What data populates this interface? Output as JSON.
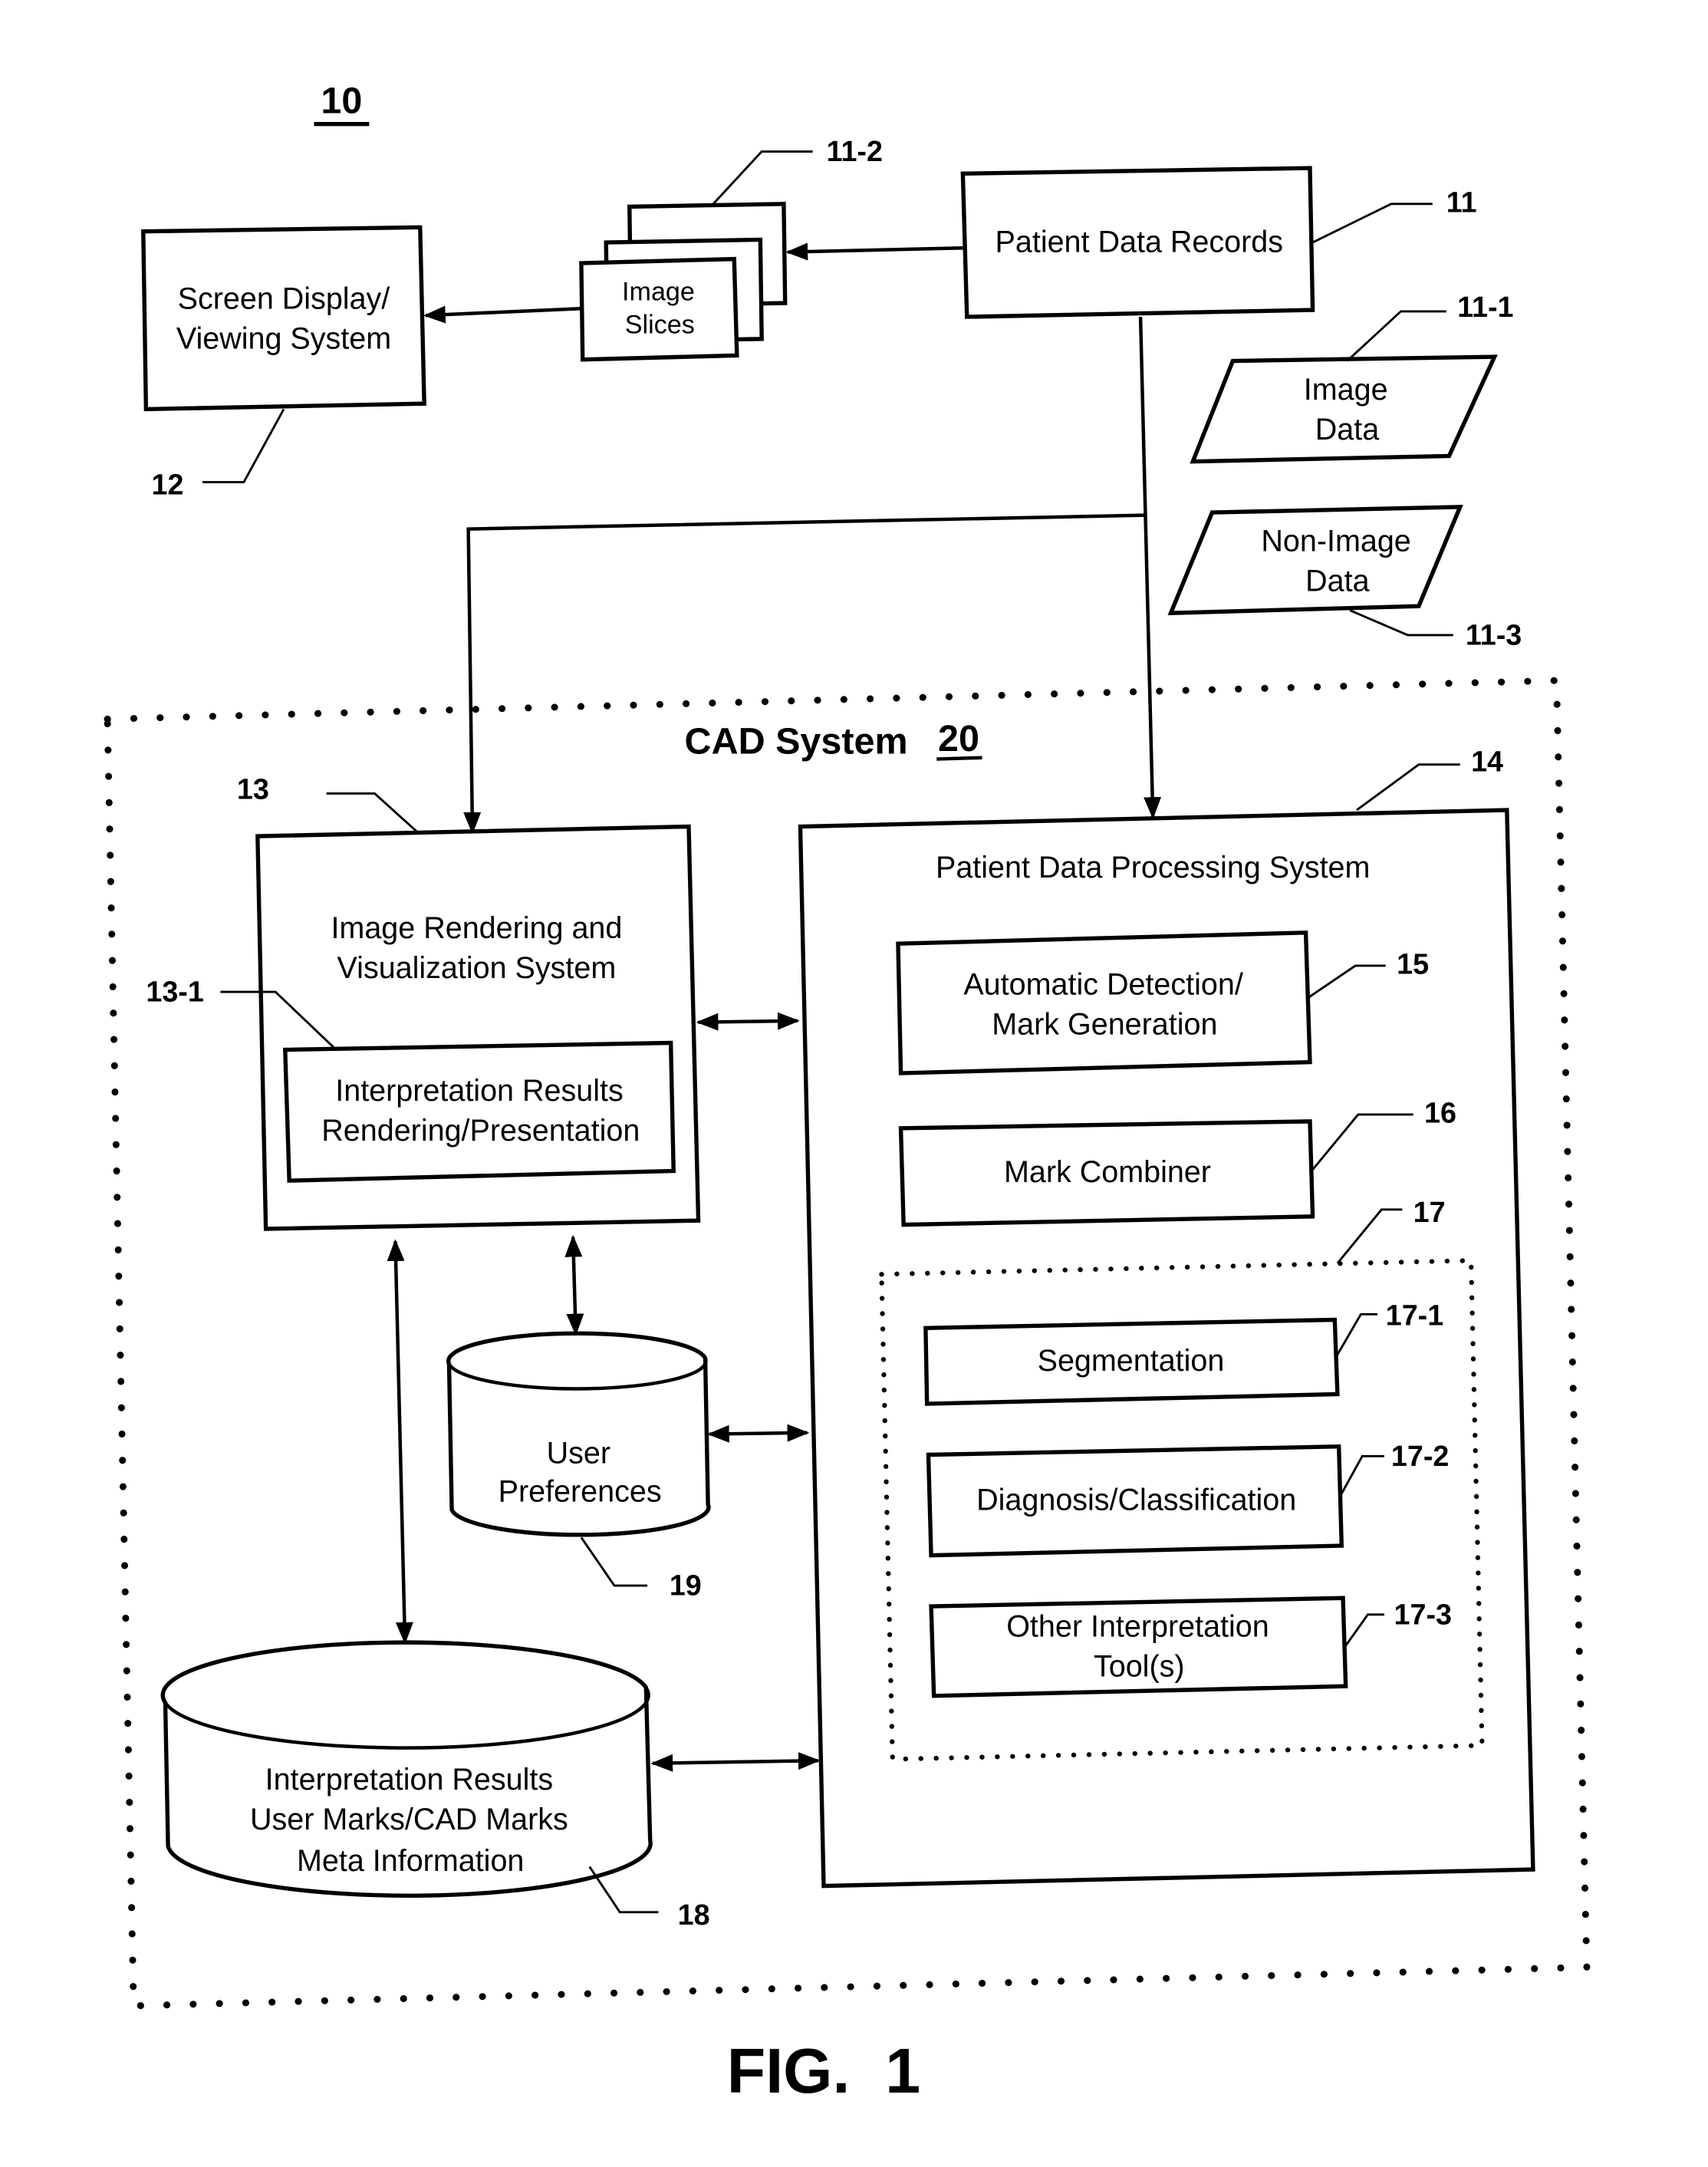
{
  "figure": {
    "number_label": "10",
    "caption": "FIG.  1"
  },
  "cad_system": {
    "label": "CAD System",
    "number": "20"
  },
  "nodes": {
    "screen_display": {
      "lines": [
        "Screen Display/",
        "Viewing System"
      ],
      "ref": "12"
    },
    "image_slices": {
      "lines": [
        "Image",
        "Slices"
      ],
      "ref": "11-2"
    },
    "patient_data_records": {
      "lines": [
        "Patient Data Records"
      ],
      "ref": "11"
    },
    "image_data": {
      "lines": [
        "Image",
        "Data"
      ],
      "ref": "11-1"
    },
    "non_image_data": {
      "lines": [
        "Non-Image",
        "Data"
      ],
      "ref": "11-3"
    },
    "image_rendering": {
      "lines": [
        "Image Rendering and",
        "Visualization System"
      ],
      "ref": "13"
    },
    "interp_rendering": {
      "lines": [
        "Interpretation Results",
        "Rendering/Presentation"
      ],
      "ref": "13-1"
    },
    "patient_processing": {
      "lines": [
        "Patient Data Processing System"
      ],
      "ref": "14"
    },
    "auto_detection": {
      "lines": [
        "Automatic Detection/",
        "Mark Generation"
      ],
      "ref": "15"
    },
    "mark_combiner": {
      "lines": [
        "Mark Combiner"
      ],
      "ref": "16"
    },
    "interp_tools_group": {
      "ref": "17"
    },
    "segmentation": {
      "lines": [
        "Segmentation"
      ],
      "ref": "17-1"
    },
    "diagnosis": {
      "lines": [
        "Diagnosis/Classification"
      ],
      "ref": "17-2"
    },
    "other_tools": {
      "lines": [
        "Other Interpretation",
        "Tool(s)"
      ],
      "ref": "17-3"
    },
    "interp_results_db": {
      "lines": [
        "Interpretation Results",
        "User Marks/CAD Marks",
        "Meta Information"
      ],
      "ref": "18"
    },
    "user_prefs_db": {
      "lines": [
        "User",
        "Preferences"
      ],
      "ref": "19"
    }
  }
}
